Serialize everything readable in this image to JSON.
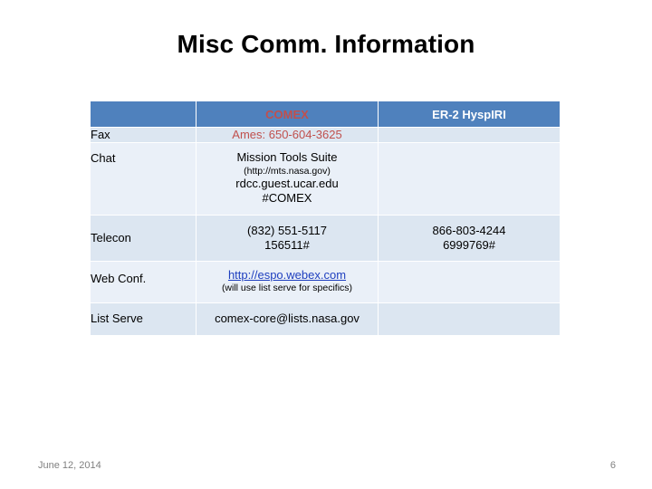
{
  "slide": {
    "title": "Misc Comm. Information",
    "footer_date": "June 12, 2014",
    "page_number": "6"
  },
  "table": {
    "headers": {
      "row_label": "",
      "comex": "COMEX",
      "er2": "ER-2 HyspIRI"
    },
    "rows": [
      {
        "label": "Fax",
        "comex_main": "Ames: 650-604-3625",
        "comex_sub": "",
        "comex_sub2": "",
        "comex_sub3": "",
        "er2_main": "",
        "er2_sub": ""
      },
      {
        "label": "Chat",
        "comex_main": "Mission Tools Suite",
        "comex_sub": "(http://mts.nasa.gov)",
        "comex_sub2": "rdcc.guest.ucar.edu",
        "comex_sub3": "#COMEX",
        "er2_main": "",
        "er2_sub": ""
      },
      {
        "label": "Telecon",
        "comex_main": "(832) 551-5117",
        "comex_sub": "156511#",
        "comex_sub2": "",
        "comex_sub3": "",
        "er2_main": "866-803-4244",
        "er2_sub": "6999769#"
      },
      {
        "label": "Web Conf.",
        "comex_main": "http://espo.webex.com",
        "comex_sub": "(will use list serve for specifics)",
        "comex_sub2": "",
        "comex_sub3": "",
        "er2_main": "",
        "er2_sub": ""
      },
      {
        "label": "List Serve",
        "comex_main": "comex-core@lists.nasa.gov",
        "comex_sub": "",
        "comex_sub2": "",
        "comex_sub3": "",
        "er2_main": "",
        "er2_sub": ""
      }
    ]
  },
  "colors": {
    "header_band": "#4f81bd",
    "header_accent_text": "#c0504d",
    "cell_fill": "#dce6f1",
    "link": "#1f3fbf"
  }
}
